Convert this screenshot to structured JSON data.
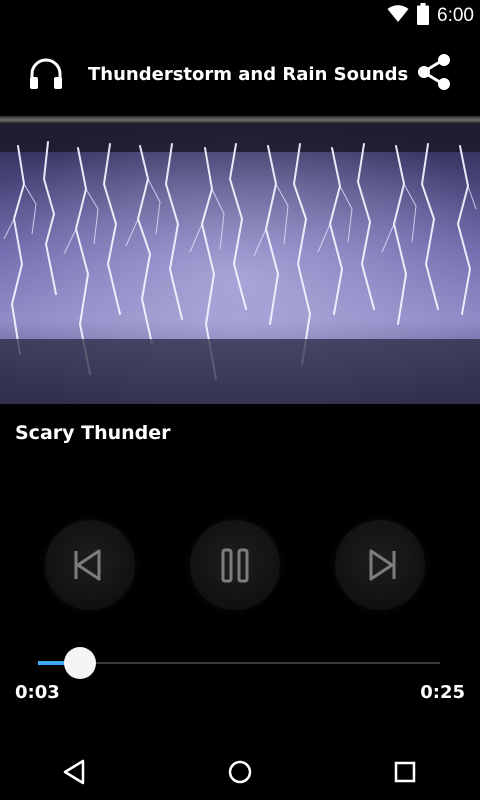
{
  "status_bar": {
    "time": "6:00",
    "icons": [
      "wifi-icon",
      "battery-icon"
    ]
  },
  "header": {
    "title": "Thunderstorm and Rain Sounds",
    "left_icon": "headphones-icon",
    "right_icon": "share-icon"
  },
  "track": {
    "name": "Scary Thunder"
  },
  "controls": {
    "prev_icon": "skip-previous-icon",
    "pause_icon": "pause-icon",
    "next_icon": "skip-next-icon"
  },
  "progress": {
    "elapsed": "0:03",
    "total": "0:25",
    "fraction": 0.105
  },
  "nav": {
    "icons": [
      "back-icon",
      "home-icon",
      "recents-icon"
    ]
  },
  "colors": {
    "background": "#000000",
    "accent": "#3fa9f5",
    "text": "#ffffff"
  }
}
